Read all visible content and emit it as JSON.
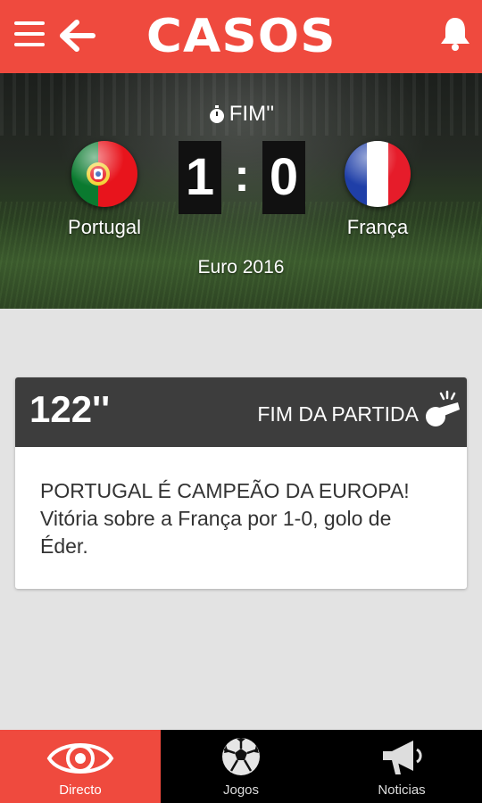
{
  "header": {
    "logo_text": "CASOS",
    "menu_icon": "hamburger-menu-icon",
    "back_icon": "arrow-left-icon",
    "notification_icon": "bell-icon"
  },
  "match": {
    "status": "FIM''",
    "home": {
      "team": "Portugal",
      "score": "1",
      "flag_icon": "portugal-flag-icon"
    },
    "away": {
      "team": "França",
      "score": "0",
      "flag_icon": "france-flag-icon"
    },
    "separator": ":",
    "competition": "Euro 2016"
  },
  "event": {
    "minute": "122''",
    "type": "FIM DA PARTIDA",
    "icon": "whistle-icon",
    "text": "PORTUGAL É CAMPEÃO DA EUROPA! Vitória sobre a França por 1-0, golo de Éder."
  },
  "nav": [
    {
      "label": "Directo",
      "icon": "eye-icon",
      "active": true
    },
    {
      "label": "Jogos",
      "icon": "soccer-ball-icon",
      "active": false
    },
    {
      "label": "Noticias",
      "icon": "megaphone-icon",
      "active": false
    }
  ],
  "colors": {
    "accent": "#ef4a3e",
    "card_header": "#3d3d3d",
    "background": "#e3e3e3",
    "nav_background": "#000000"
  }
}
